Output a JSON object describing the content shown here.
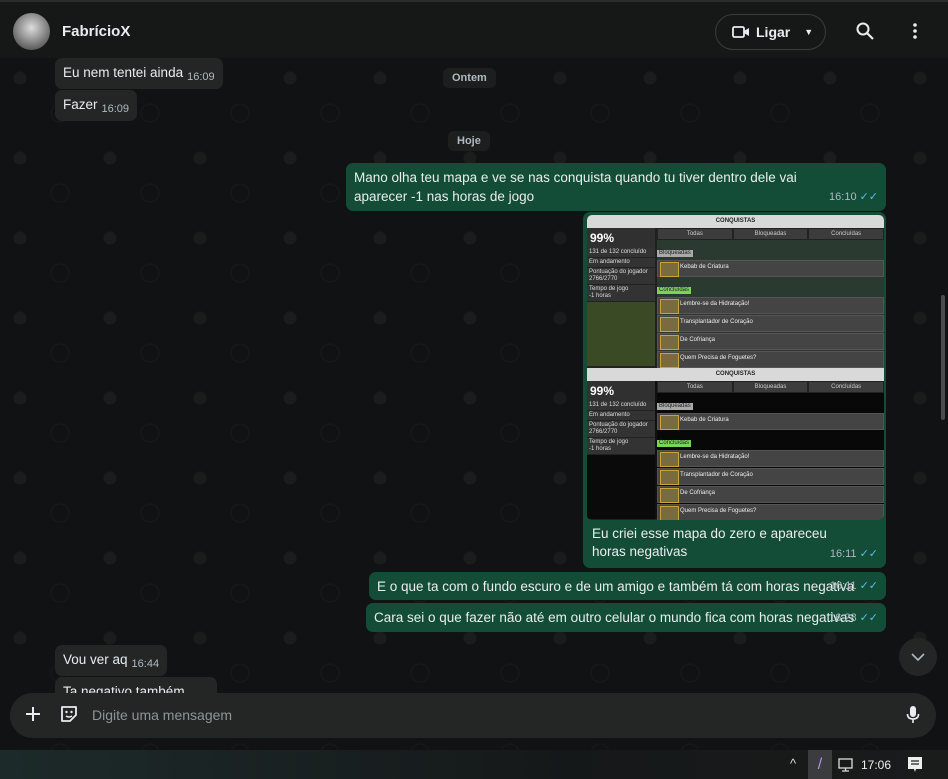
{
  "header": {
    "contact_name": "FabrícioX",
    "call_label": "Ligar"
  },
  "date_chips": [
    "Ontem",
    "Hoje"
  ],
  "messages": [
    {
      "dir": "in",
      "text": "Eu nem tentei ainda",
      "time": "16:09"
    },
    {
      "dir": "in",
      "text": "Fazer",
      "time": "16:09"
    },
    {
      "dir": "out",
      "text": "Mano olha teu mapa e ve se nas conquista quando tu tiver dentro dele vai aparecer -1 nas horas de jogo",
      "time": "16:10",
      "read": true
    },
    {
      "dir": "out",
      "caption": "Eu criei esse mapa do zero e apareceu horas negativas",
      "time": "16:11",
      "read": true
    },
    {
      "dir": "out",
      "text": "E o que ta com o fundo escuro e de um amigo e também tá com horas negativa",
      "time": "16:11",
      "read": true
    },
    {
      "dir": "out",
      "text": "Cara sei o que fazer não até em outro celular o mundo fica com horas negativas",
      "time": "16:28",
      "read": true
    },
    {
      "dir": "in",
      "text": "Vou ver aq",
      "time": "16:44"
    },
    {
      "dir": "in",
      "text": "Ta negativo também"
    }
  ],
  "screenshot": {
    "title": "CONQUISTAS",
    "percent": "99%",
    "progress": "131 de 132 concluído",
    "stats": [
      "Em andamento",
      "Pontuação do jogador",
      "2766/2770",
      "Tempo de jogo",
      "-1 horas"
    ],
    "tabs": [
      "Todas",
      "Bloqueadas",
      "Concluídas"
    ],
    "sections": [
      "Bloqueadas",
      "Concluídas"
    ],
    "achievements": [
      "Kebab de Criatura",
      "Lembre-se da Hidratação!",
      "Transplantador de Coração",
      "De Cofriança",
      "Quem Precisa de Foguetes?"
    ]
  },
  "input": {
    "placeholder": "Digite uma mensagem"
  },
  "taskbar": {
    "clock": "17:06"
  },
  "colors": {
    "outgoing": "#144d37",
    "incoming": "#242626",
    "read_ticks": "#53bdeb"
  }
}
